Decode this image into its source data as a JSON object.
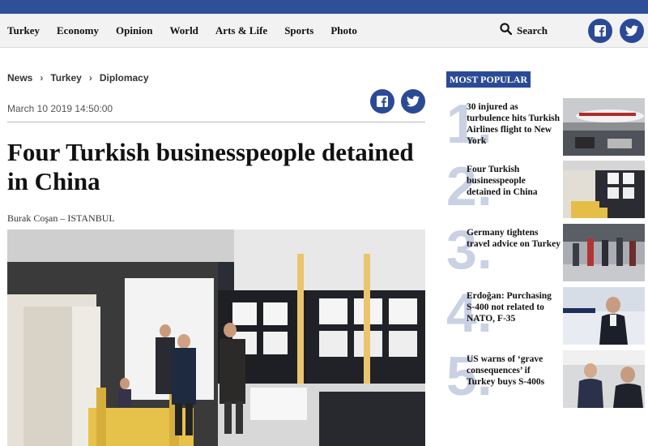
{
  "nav": {
    "items": [
      "Turkey",
      "Economy",
      "Opinion",
      "World",
      "Arts & Life",
      "Sports",
      "Photo"
    ],
    "search_label": "Search",
    "search_icon": "search-icon",
    "social_icons": [
      "facebook-icon",
      "twitter-icon"
    ]
  },
  "breadcrumb": [
    "News",
    "Turkey",
    "Diplomacy"
  ],
  "article": {
    "date": "March 10 2019 14:50:00",
    "title": "Four Turkish businesspeople detained in China",
    "byline": "Burak Coşan – ISTANBUL"
  },
  "most_popular": {
    "title": "MOST POPULAR",
    "items": [
      {
        "number": "1.",
        "title": "30 injured as turbulence hits Turkish Airlines flight to New York"
      },
      {
        "number": "2.",
        "title": "Four Turkish businesspeople detained in China"
      },
      {
        "number": "3.",
        "title": "Germany tightens travel advice on Turkey"
      },
      {
        "number": "4.",
        "title": "Erdoğan: Purchasing S-400 not related to NATO, F-35"
      },
      {
        "number": "5.",
        "title": "US warns of ‘grave consequences’ if Turkey buys S-400s"
      }
    ]
  },
  "colors": {
    "brand": "#2b4a96",
    "topbar": "#2f4f99",
    "number_watermark": "#c9d1e3"
  }
}
